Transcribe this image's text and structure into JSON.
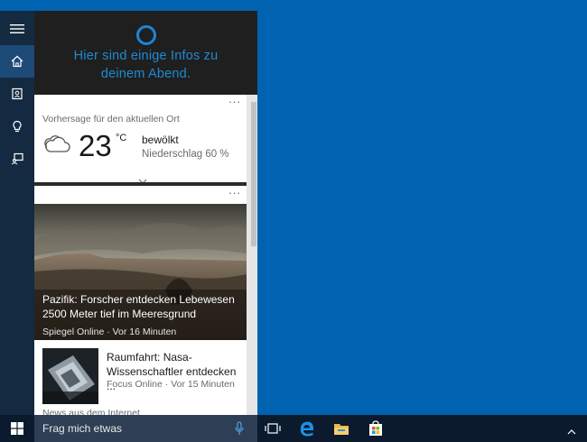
{
  "cortana": {
    "greeting_line1": "Hier sind einige Infos zu",
    "greeting_line2": "deinem Abend.",
    "rail": [
      "hamburger-menu-icon",
      "home-icon",
      "notebook-icon",
      "lightbulb-icon",
      "feedback-icon"
    ]
  },
  "weather": {
    "title": "Vorhersage für den aktuellen Ort",
    "temperature": "23",
    "unit": "°C",
    "condition": "bewölkt",
    "precipitation": "Niederschlag 60 %",
    "more": "...",
    "icon": "cloudy-icon"
  },
  "news": {
    "more": "...",
    "items": [
      {
        "title": "Pazifik: Forscher entdecken Lebewesen 2500 Meter tief im Meeresgrund",
        "source": "Spiegel Online · Vor 16 Minuten"
      },
      {
        "title": "Raumfahrt: Nasa-Wissenschaftler entdecken ...",
        "source": "Focus Online · Vor 15 Minuten"
      }
    ],
    "footer": "News aus dem Internet"
  },
  "taskbar": {
    "search_placeholder": "Frag mich etwas",
    "icons": [
      "windows-start-icon",
      "microphone-icon",
      "task-view-icon",
      "edge-icon",
      "file-explorer-icon",
      "store-icon",
      "tray-chevron-up-icon"
    ]
  },
  "colors": {
    "desktop": "#0063b1",
    "accent": "#1f8ad4",
    "taskbar": "#0b1a2d"
  }
}
